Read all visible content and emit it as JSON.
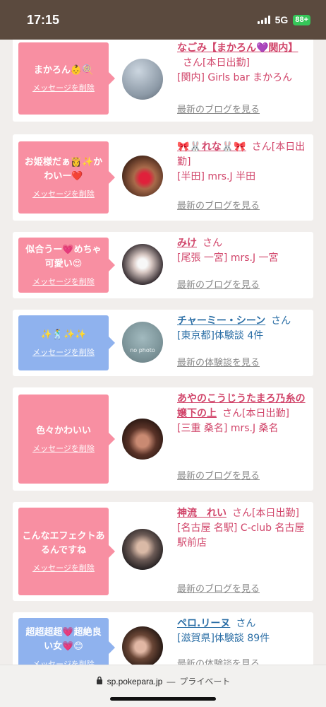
{
  "status_bar": {
    "time": "17:15",
    "network": "5G",
    "battery": "88+"
  },
  "cards": [
    {
      "message": "まかろん👶🍭",
      "delete_label": "メッセージを削除",
      "name": "なごみ【まかろん💜関内】",
      "san": "さん",
      "status": "[本日出勤]",
      "location": "[関内] Girls bar まかろん",
      "link": "最新のブログを見る"
    },
    {
      "message": "お姫様だぁ👸✨かわいー❤️",
      "delete_label": "メッセージを削除",
      "name": "🎀🐰れな🐰🎀",
      "san": "さん",
      "status": "[本日出勤]",
      "location": "[半田] mrs.J 半田",
      "link": "最新のブログを見る"
    },
    {
      "message": "似合うー💗めちゃ可愛い😍",
      "delete_label": "メッセージを削除",
      "name": "みけ",
      "san": "さん",
      "location": "[尾張 一宮] mrs.J 一宮",
      "link": "最新のブログを見る"
    },
    {
      "message": "✨🕺✨✨",
      "delete_label": "メッセージを削除",
      "name": "チャーミー・シーン",
      "san": "さん",
      "location": "[東京都]体験談 4件",
      "link": "最新の体験談を見る",
      "avatar_text": "no photo"
    },
    {
      "message": "色々かわいい",
      "delete_label": "メッセージを削除",
      "name": "あやのこうじうたまろ乃糸の嬢下の上",
      "san": "さん",
      "status": "[本日出勤]",
      "location": "[三重 桑名] mrs.J 桑名",
      "link": "最新のブログを見る"
    },
    {
      "message": "こんなエフェクトあるんですね",
      "delete_label": "メッセージを削除",
      "name": "神流　れい",
      "san": "さん",
      "status": "[本日出勤]",
      "location": "[名古屋 名駅] C-club 名古屋駅前店",
      "link": "最新のブログを見る"
    },
    {
      "message": "超超超超💗超絶良い女💗😊",
      "delete_label": "メッセージを削除",
      "name": "ペロ.リーヌ",
      "san": "さん",
      "location": "[滋賀県]体験談 89件",
      "link": "最新の体験談を見る"
    }
  ],
  "url_bar": {
    "url": "sp.pokepara.jp",
    "separator": "—",
    "mode": "プライベート"
  }
}
